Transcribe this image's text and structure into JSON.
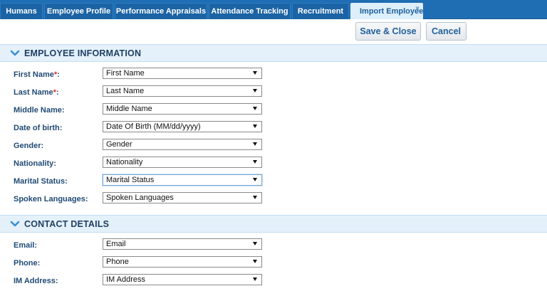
{
  "tabs": [
    {
      "label": "Humans"
    },
    {
      "label": "Employee Profile"
    },
    {
      "label": "Performance Appraisals"
    },
    {
      "label": "Attendance Tracking"
    },
    {
      "label": "Recruitment"
    },
    {
      "label": "Import Employee",
      "active": true,
      "close": "×"
    }
  ],
  "toolbar": {
    "save_label": "Save & Close",
    "cancel_label": "Cancel"
  },
  "sections": {
    "employee": {
      "title": "EMPLOYEE INFORMATION",
      "fields": [
        {
          "label": "First Name",
          "required": "*",
          "suffix": ":",
          "value": "First Name"
        },
        {
          "label": "Last Name",
          "required": "*",
          "suffix": ":",
          "value": "Last Name"
        },
        {
          "label": "Middle Name:",
          "value": "Middle Name"
        },
        {
          "label": "Date of birth:",
          "value": "Date Of Birth (MM/dd/yyyy)"
        },
        {
          "label": "Gender:",
          "value": "Gender"
        },
        {
          "label": "Nationality:",
          "value": "Nationality"
        },
        {
          "label": "Marital Status:",
          "value": "Marital Status"
        },
        {
          "label": "Spoken Languages:",
          "value": "Spoken Languages"
        }
      ]
    },
    "contact": {
      "title": "CONTACT DETAILS",
      "fields": [
        {
          "label": "Email:",
          "value": "Email"
        },
        {
          "label": "Phone:",
          "value": "Phone"
        },
        {
          "label": "IM Address:",
          "value": "IM Address"
        }
      ]
    }
  },
  "colors": {
    "tabbar": "#1f6db2",
    "active_tab": "#dceffa",
    "section_bg": "#e4f1fb",
    "label": "#204a74",
    "required": "#e02b2b"
  },
  "icons": {
    "section_toggle": "chevron-down-icon",
    "dropdown": "dropdown-arrow-icon",
    "tab_close": "close-icon"
  }
}
